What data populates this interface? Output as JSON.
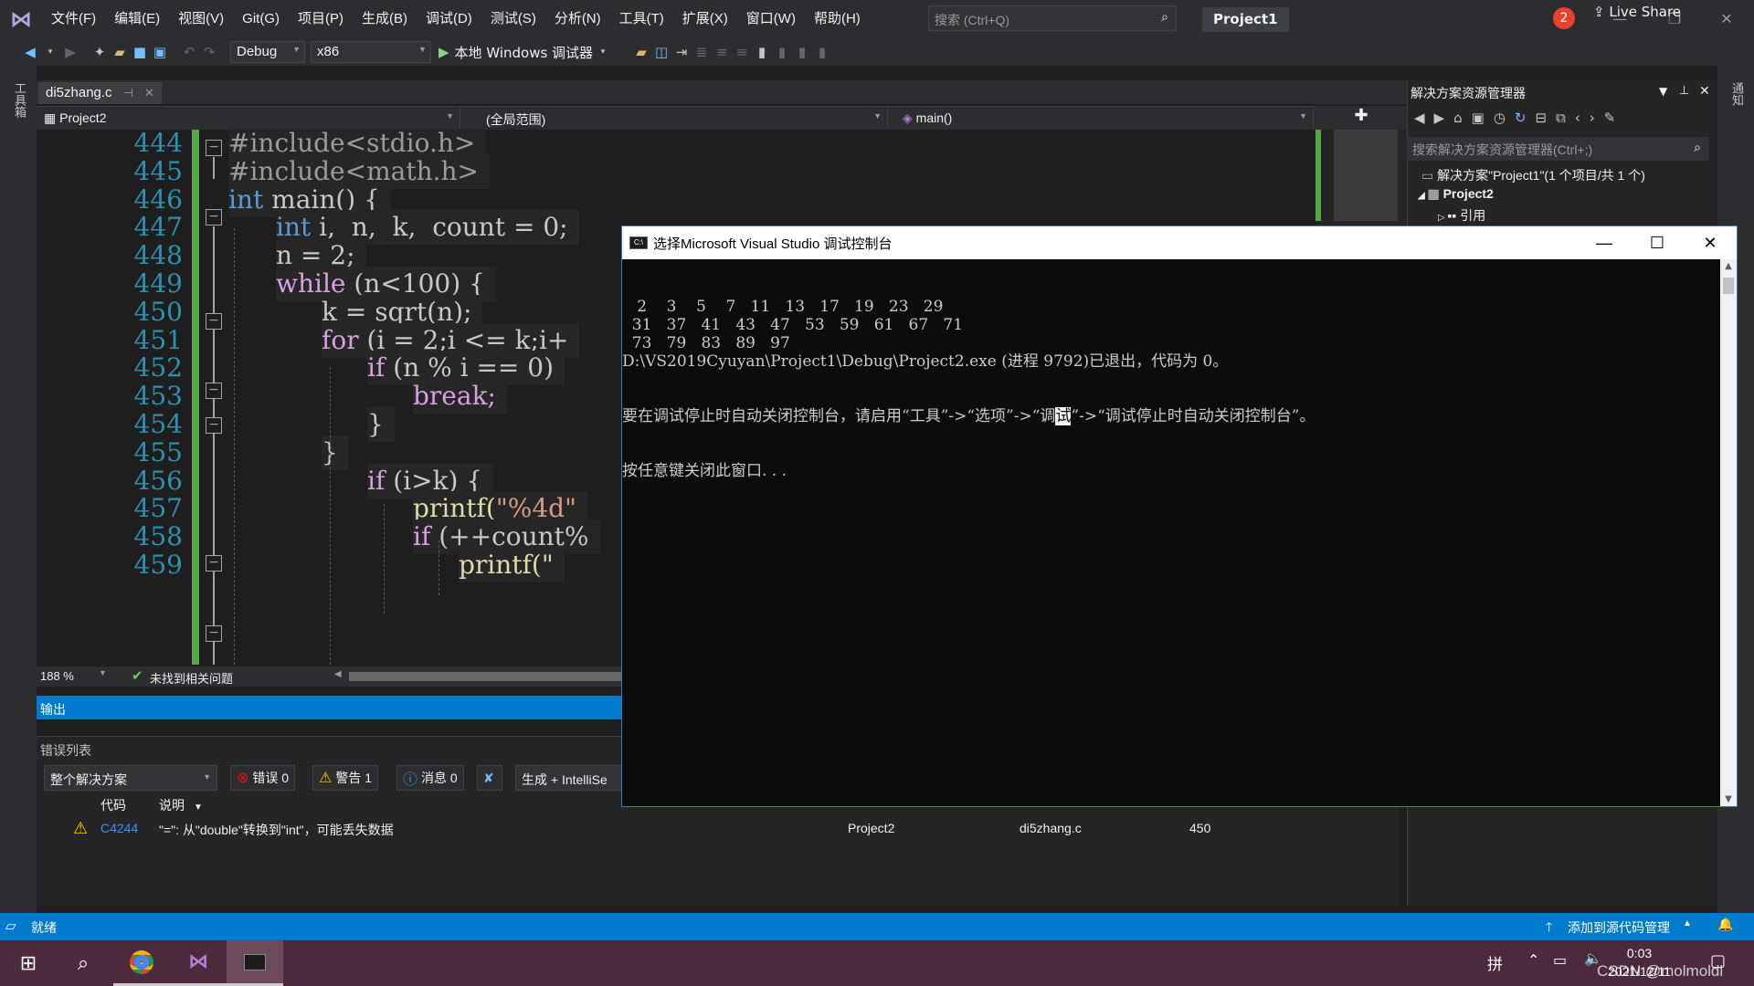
{
  "menu": [
    "文件(F)",
    "编辑(E)",
    "视图(V)",
    "Git(G)",
    "项目(P)",
    "生成(B)",
    "调试(D)",
    "测试(S)",
    "分析(N)",
    "工具(T)",
    "扩展(X)",
    "窗口(W)",
    "帮助(H)"
  ],
  "search_placeholder": "搜索 (Ctrl+Q)",
  "project_title": "Project1",
  "notification_count": "2",
  "toolbar": {
    "config": "Debug",
    "platform": "x86",
    "debugger": "本地 Windows 调试器",
    "live_share": "Live Share"
  },
  "left_rail_label": "工具箱",
  "right_rail_label": "通知",
  "doc_tab": "di5zhang.c",
  "nav": {
    "project": "Project2",
    "scope": "(全局范围)",
    "member": "main()"
  },
  "editor": {
    "zoom": "188 %",
    "issues": "未找到相关问题",
    "line_numbers": [
      "444",
      "445",
      "446",
      "447",
      "448",
      "449",
      "450",
      "451",
      "452",
      "453",
      "454",
      "455",
      "456",
      "457",
      "458",
      "459"
    ],
    "code": {
      "l444": "#include<stdio.h>",
      "l445": "#include<math.h>",
      "l446_kw": "int",
      "l446_rest": " main() {",
      "l447_kw": "int",
      "l447_rest": " i,  n,  k,  count = 0;",
      "l448": "n = 2;",
      "l449_kw": "while",
      "l449_rest": " (n<100) {",
      "l450": "k = sqrt(n);",
      "l451_kw": "for",
      "l451_rest": " (i = 2;i <= k;i+",
      "l452_kw": "if",
      "l452_rest": " (n % i == 0)",
      "l453": "break;",
      "l454": "}",
      "l455": "}",
      "l456_kw": "if",
      "l456_rest": " (i>k) {",
      "l457_fn": "printf(",
      "l457_str": "\"%4d\"",
      "l458_kw": "if",
      "l458_rest": " (++count%",
      "l459": "printf(\""
    }
  },
  "output_header": "输出",
  "error_list": {
    "title": "错误列表",
    "scope": "整个解决方案",
    "errors": "错误 0",
    "warnings": "警告 1",
    "messages": "消息 0",
    "build_filter": "生成 + IntelliSe",
    "columns": {
      "code": "代码",
      "desc": "说明"
    },
    "row": {
      "code": "C4244",
      "desc": "\"=\": 从\"double\"转换到\"int\"，可能丢失数据",
      "project": "Project2",
      "file": "di5zhang.c",
      "line": "450"
    }
  },
  "solution_explorer": {
    "title": "解决方案资源管理器",
    "search": "搜索解决方案资源管理器(Ctrl+;)",
    "solution": "解决方案\"Project1\"(1 个项目/共 1 个)",
    "project": "Project2",
    "references": "引用"
  },
  "console": {
    "title": "选择Microsoft Visual Studio 调试控制台",
    "lines": [
      "   2    3    5    7   11   13   17   19   23   29",
      "  31   37   41   43   47   53   59   61   67   71",
      "  73   79   83   89   97",
      "D:\\VS2019Cyuyan\\Project1\\Debug\\Project2.exe (进程 9792)已退出，代码为 0。"
    ],
    "hint_a": "要在调试停止时自动关闭控制台，请启用“工具”->“选项”->“调",
    "hint_sel": "试",
    "hint_b": "”->“调试停止时自动关闭控制台”。",
    "press_key": "按任意键关闭此窗口. . ."
  },
  "status": {
    "ready": "就绪",
    "source_control": "添加到源代码管理"
  },
  "clock": {
    "time": "0:03",
    "date": "2021/12/11"
  },
  "ime": "拼",
  "watermark": "CSDN @molmoldl"
}
